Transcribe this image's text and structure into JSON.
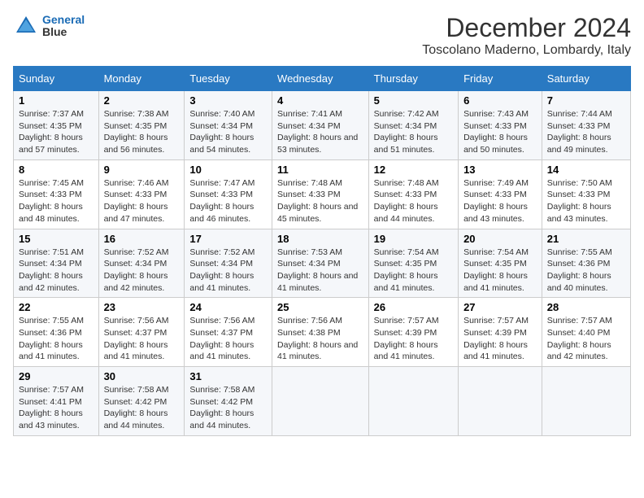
{
  "logo": {
    "line1": "General",
    "line2": "Blue"
  },
  "title": "December 2024",
  "subtitle": "Toscolano Maderno, Lombardy, Italy",
  "weekdays": [
    "Sunday",
    "Monday",
    "Tuesday",
    "Wednesday",
    "Thursday",
    "Friday",
    "Saturday"
  ],
  "weeks": [
    [
      {
        "day": "1",
        "sunrise": "Sunrise: 7:37 AM",
        "sunset": "Sunset: 4:35 PM",
        "daylight": "Daylight: 8 hours and 57 minutes."
      },
      {
        "day": "2",
        "sunrise": "Sunrise: 7:38 AM",
        "sunset": "Sunset: 4:35 PM",
        "daylight": "Daylight: 8 hours and 56 minutes."
      },
      {
        "day": "3",
        "sunrise": "Sunrise: 7:40 AM",
        "sunset": "Sunset: 4:34 PM",
        "daylight": "Daylight: 8 hours and 54 minutes."
      },
      {
        "day": "4",
        "sunrise": "Sunrise: 7:41 AM",
        "sunset": "Sunset: 4:34 PM",
        "daylight": "Daylight: 8 hours and 53 minutes."
      },
      {
        "day": "5",
        "sunrise": "Sunrise: 7:42 AM",
        "sunset": "Sunset: 4:34 PM",
        "daylight": "Daylight: 8 hours and 51 minutes."
      },
      {
        "day": "6",
        "sunrise": "Sunrise: 7:43 AM",
        "sunset": "Sunset: 4:33 PM",
        "daylight": "Daylight: 8 hours and 50 minutes."
      },
      {
        "day": "7",
        "sunrise": "Sunrise: 7:44 AM",
        "sunset": "Sunset: 4:33 PM",
        "daylight": "Daylight: 8 hours and 49 minutes."
      }
    ],
    [
      {
        "day": "8",
        "sunrise": "Sunrise: 7:45 AM",
        "sunset": "Sunset: 4:33 PM",
        "daylight": "Daylight: 8 hours and 48 minutes."
      },
      {
        "day": "9",
        "sunrise": "Sunrise: 7:46 AM",
        "sunset": "Sunset: 4:33 PM",
        "daylight": "Daylight: 8 hours and 47 minutes."
      },
      {
        "day": "10",
        "sunrise": "Sunrise: 7:47 AM",
        "sunset": "Sunset: 4:33 PM",
        "daylight": "Daylight: 8 hours and 46 minutes."
      },
      {
        "day": "11",
        "sunrise": "Sunrise: 7:48 AM",
        "sunset": "Sunset: 4:33 PM",
        "daylight": "Daylight: 8 hours and 45 minutes."
      },
      {
        "day": "12",
        "sunrise": "Sunrise: 7:48 AM",
        "sunset": "Sunset: 4:33 PM",
        "daylight": "Daylight: 8 hours and 44 minutes."
      },
      {
        "day": "13",
        "sunrise": "Sunrise: 7:49 AM",
        "sunset": "Sunset: 4:33 PM",
        "daylight": "Daylight: 8 hours and 43 minutes."
      },
      {
        "day": "14",
        "sunrise": "Sunrise: 7:50 AM",
        "sunset": "Sunset: 4:33 PM",
        "daylight": "Daylight: 8 hours and 43 minutes."
      }
    ],
    [
      {
        "day": "15",
        "sunrise": "Sunrise: 7:51 AM",
        "sunset": "Sunset: 4:34 PM",
        "daylight": "Daylight: 8 hours and 42 minutes."
      },
      {
        "day": "16",
        "sunrise": "Sunrise: 7:52 AM",
        "sunset": "Sunset: 4:34 PM",
        "daylight": "Daylight: 8 hours and 42 minutes."
      },
      {
        "day": "17",
        "sunrise": "Sunrise: 7:52 AM",
        "sunset": "Sunset: 4:34 PM",
        "daylight": "Daylight: 8 hours and 41 minutes."
      },
      {
        "day": "18",
        "sunrise": "Sunrise: 7:53 AM",
        "sunset": "Sunset: 4:34 PM",
        "daylight": "Daylight: 8 hours and 41 minutes."
      },
      {
        "day": "19",
        "sunrise": "Sunrise: 7:54 AM",
        "sunset": "Sunset: 4:35 PM",
        "daylight": "Daylight: 8 hours and 41 minutes."
      },
      {
        "day": "20",
        "sunrise": "Sunrise: 7:54 AM",
        "sunset": "Sunset: 4:35 PM",
        "daylight": "Daylight: 8 hours and 41 minutes."
      },
      {
        "day": "21",
        "sunrise": "Sunrise: 7:55 AM",
        "sunset": "Sunset: 4:36 PM",
        "daylight": "Daylight: 8 hours and 40 minutes."
      }
    ],
    [
      {
        "day": "22",
        "sunrise": "Sunrise: 7:55 AM",
        "sunset": "Sunset: 4:36 PM",
        "daylight": "Daylight: 8 hours and 41 minutes."
      },
      {
        "day": "23",
        "sunrise": "Sunrise: 7:56 AM",
        "sunset": "Sunset: 4:37 PM",
        "daylight": "Daylight: 8 hours and 41 minutes."
      },
      {
        "day": "24",
        "sunrise": "Sunrise: 7:56 AM",
        "sunset": "Sunset: 4:37 PM",
        "daylight": "Daylight: 8 hours and 41 minutes."
      },
      {
        "day": "25",
        "sunrise": "Sunrise: 7:56 AM",
        "sunset": "Sunset: 4:38 PM",
        "daylight": "Daylight: 8 hours and 41 minutes."
      },
      {
        "day": "26",
        "sunrise": "Sunrise: 7:57 AM",
        "sunset": "Sunset: 4:39 PM",
        "daylight": "Daylight: 8 hours and 41 minutes."
      },
      {
        "day": "27",
        "sunrise": "Sunrise: 7:57 AM",
        "sunset": "Sunset: 4:39 PM",
        "daylight": "Daylight: 8 hours and 41 minutes."
      },
      {
        "day": "28",
        "sunrise": "Sunrise: 7:57 AM",
        "sunset": "Sunset: 4:40 PM",
        "daylight": "Daylight: 8 hours and 42 minutes."
      }
    ],
    [
      {
        "day": "29",
        "sunrise": "Sunrise: 7:57 AM",
        "sunset": "Sunset: 4:41 PM",
        "daylight": "Daylight: 8 hours and 43 minutes."
      },
      {
        "day": "30",
        "sunrise": "Sunrise: 7:58 AM",
        "sunset": "Sunset: 4:42 PM",
        "daylight": "Daylight: 8 hours and 44 minutes."
      },
      {
        "day": "31",
        "sunrise": "Sunrise: 7:58 AM",
        "sunset": "Sunset: 4:42 PM",
        "daylight": "Daylight: 8 hours and 44 minutes."
      },
      null,
      null,
      null,
      null
    ]
  ]
}
